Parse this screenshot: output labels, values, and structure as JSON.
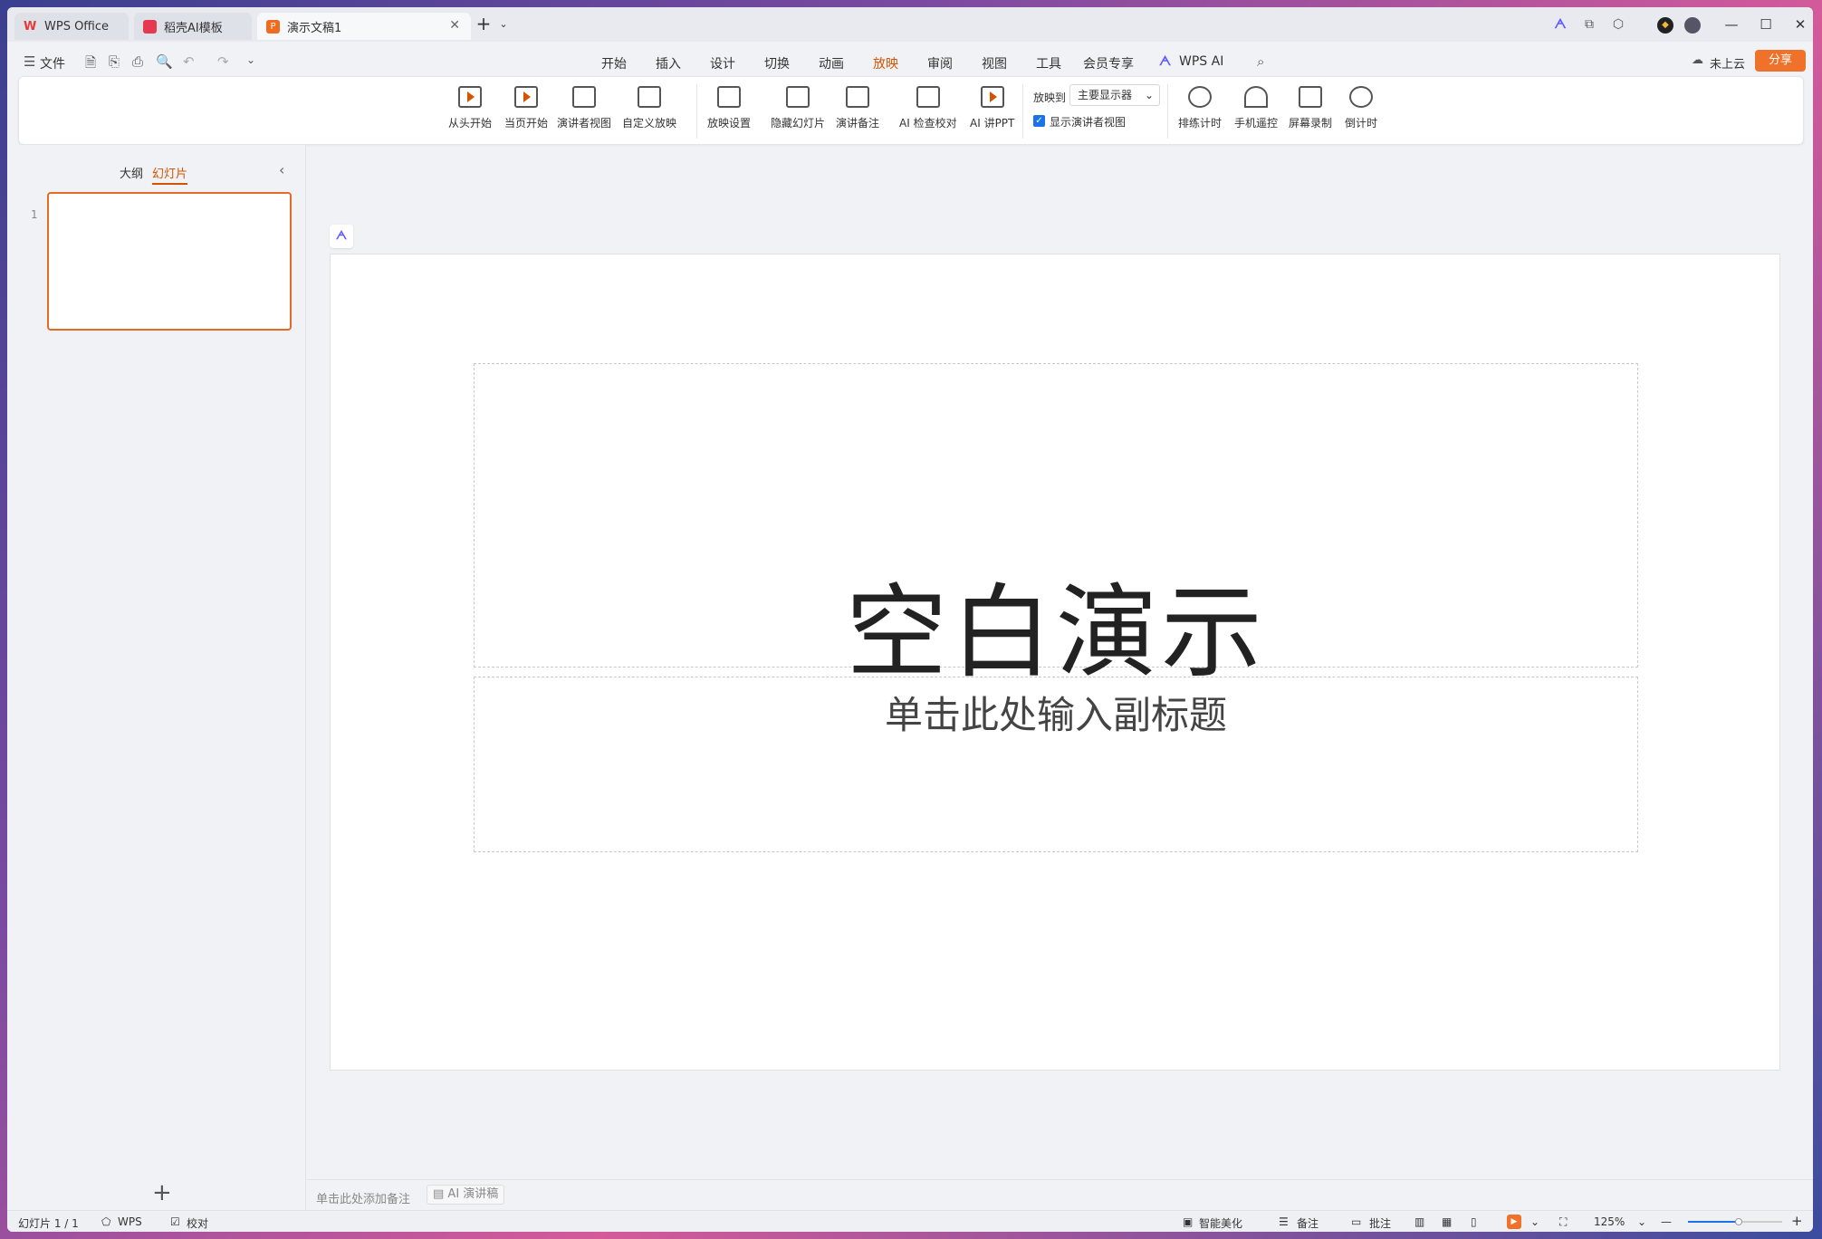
{
  "tabs": [
    {
      "label": "WPS Office",
      "color": "#e63939"
    },
    {
      "label": "稻壳AI模板",
      "color": "#e63950"
    },
    {
      "label": "演示文稿1",
      "color": "#f06a1f",
      "active": true
    }
  ],
  "menu": {
    "file": "文件",
    "items": [
      "开始",
      "插入",
      "设计",
      "切换",
      "动画",
      "放映",
      "审阅",
      "视图",
      "工具",
      "会员专享"
    ],
    "active": "放映",
    "ai": "WPS AI",
    "cloud": "未上云",
    "share": "分享"
  },
  "ribbon": {
    "group1": [
      "从头开始",
      "当页开始",
      "演讲者视图",
      "自定义放映"
    ],
    "group2": [
      "放映设置",
      "隐藏幻灯片",
      "演讲备注",
      "AI 检查校对",
      "AI 讲PPT"
    ],
    "play_to_label": "放映到",
    "play_to_value": "主要显示器",
    "presenter_check": "显示演讲者视图",
    "group3": [
      "排练计时",
      "手机遥控",
      "屏幕录制",
      "倒计时"
    ]
  },
  "leftpanel": {
    "outline": "大纲",
    "slides": "幻灯片",
    "slide_number": "1"
  },
  "slide": {
    "title": "空白演示",
    "subtitle": "单击此处输入副标题"
  },
  "notes": {
    "placeholder": "单击此处添加备注",
    "ai": "AI 演讲稿"
  },
  "status": {
    "slide_count": "幻灯片 1 / 1",
    "wps": "WPS",
    "proof": "校对",
    "beautify": "智能美化",
    "notes": "备注",
    "comment": "批注",
    "zoom": "125%"
  },
  "colors": {
    "accent": "#d35400",
    "share_bg": "#f0712a"
  }
}
